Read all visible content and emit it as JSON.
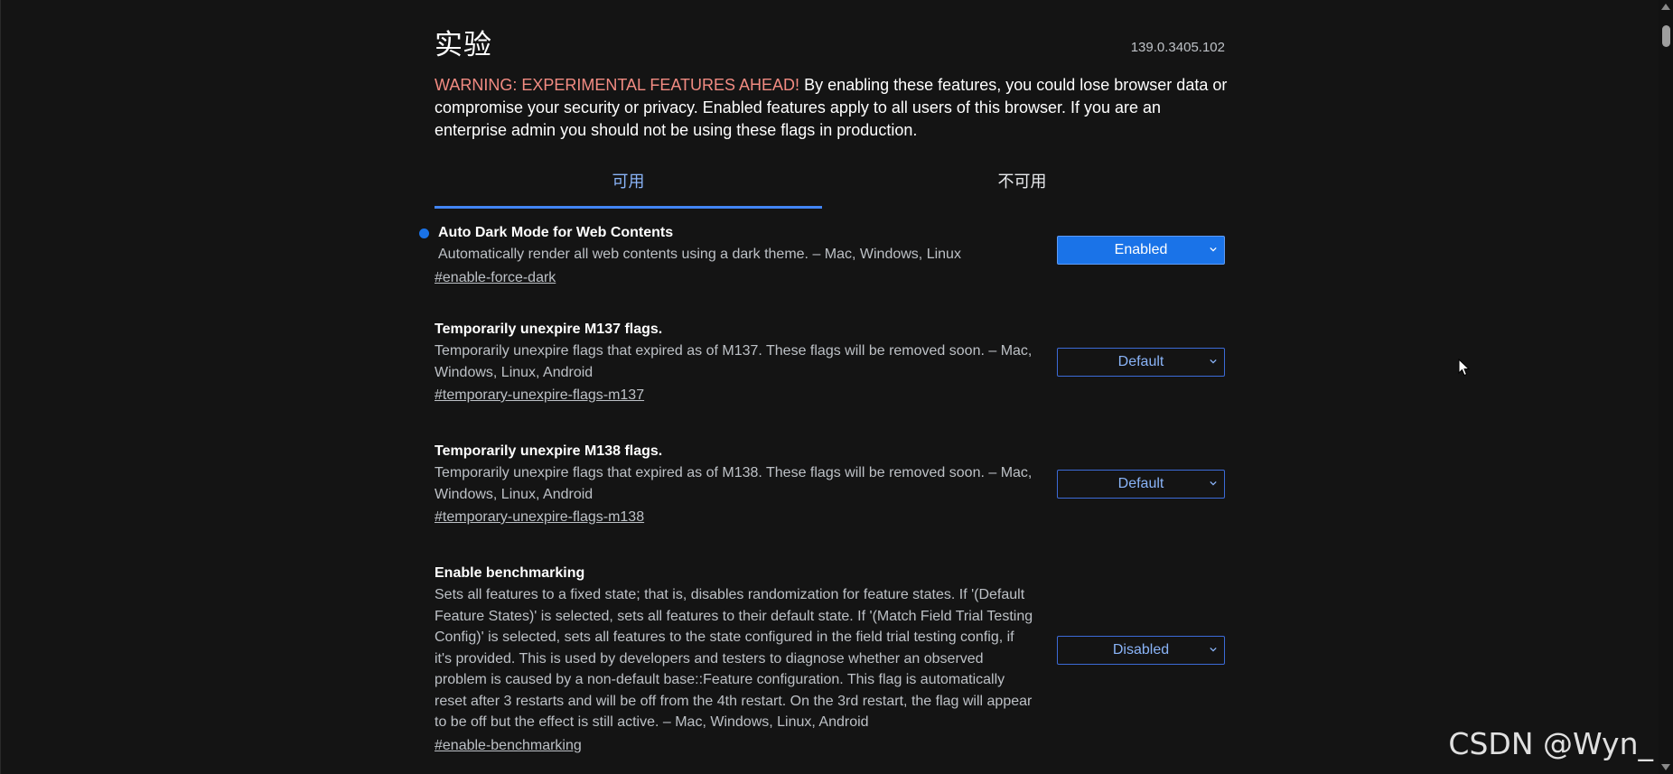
{
  "page": {
    "title": "实验",
    "version": "139.0.3405.102"
  },
  "warning": {
    "label": "WARNING: EXPERIMENTAL FEATURES AHEAD!",
    "text": " By enabling these features, you could lose browser data or compromise your security or privacy. Enabled features apply to all users of this browser. If you are an enterprise admin you should not be using these flags in production."
  },
  "tabs": [
    {
      "label": "可用",
      "active": true
    },
    {
      "label": "不可用",
      "active": false
    }
  ],
  "flags": [
    {
      "name": "Auto Dark Mode for Web Contents",
      "description": "Automatically render all web contents using a dark theme. – Mac, Windows, Linux",
      "link": "#enable-force-dark",
      "value": "Enabled",
      "modified": true
    },
    {
      "name": "Temporarily unexpire M137 flags.",
      "description": "Temporarily unexpire flags that expired as of M137. These flags will be removed soon. – Mac, Windows, Linux, Android",
      "link": "#temporary-unexpire-flags-m137",
      "value": "Default",
      "modified": false
    },
    {
      "name": "Temporarily unexpire M138 flags.",
      "description": "Temporarily unexpire flags that expired as of M138. These flags will be removed soon. – Mac, Windows, Linux, Android",
      "link": "#temporary-unexpire-flags-m138",
      "value": "Default",
      "modified": false
    },
    {
      "name": "Enable benchmarking",
      "description": "Sets all features to a fixed state; that is, disables randomization for feature states. If '(Default Feature States)' is selected, sets all features to their default state. If '(Match Field Trial Testing Config)' is selected, sets all features to the state configured in the field trial testing config, if it's provided. This is used by developers and testers to diagnose whether an observed problem is caused by a non-default base::Feature configuration. This flag is automatically reset after 3 restarts and will be off from the 4th restart. On the 3rd restart, the flag will appear to be off but the effect is still active. – Mac, Windows, Linux, Android",
      "link": "#enable-benchmarking",
      "value": "Disabled",
      "modified": false
    }
  ],
  "watermark": "CSDN @Wyn_",
  "icons": {
    "chevron": "chevron-down-icon",
    "cursor": "mouse-cursor-icon"
  },
  "colors": {
    "accent": "#1a73e8",
    "link_blue": "#8ab4f8",
    "warning_red": "#f28b82",
    "background": "#141414"
  }
}
